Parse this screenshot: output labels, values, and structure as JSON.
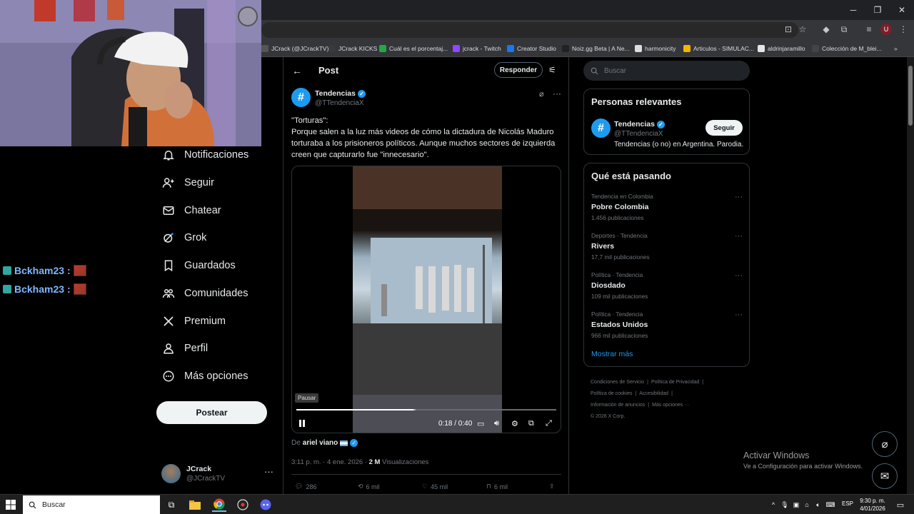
{
  "browser": {
    "window_controls": [
      "─",
      "❐",
      "✕"
    ],
    "bookmarks": [
      {
        "label": "JCrack (@JCrackTV)...",
        "color": "#555555"
      },
      {
        "label": "JCrack KICKS",
        "color": "#3a3a3a"
      },
      {
        "label": "Cuál es el porcentaj...",
        "color": "#22a845"
      },
      {
        "label": "jcrack - Twitch",
        "color": "#9146ff"
      },
      {
        "label": "Creator Studio",
        "color": "#1877f2"
      },
      {
        "label": "Noiz.gg Beta | A Ne...",
        "color": "#222222"
      },
      {
        "label": "harmonicity",
        "color": "#dddddd"
      },
      {
        "label": "Articulos - SIMULAC...",
        "color": "#f4b400"
      },
      {
        "label": "aldrinjaramillo",
        "color": "#e5e5e5"
      },
      {
        "label": "Colección de M_blei...",
        "color": "#444444"
      }
    ]
  },
  "chat": [
    {
      "user": "Bckham23",
      "sep": ":"
    },
    {
      "user": "Bckham23",
      "sep": ":"
    }
  ],
  "nav": {
    "items": [
      {
        "label": "Notificaciones",
        "icon": "bell-icon"
      },
      {
        "label": "Seguir",
        "icon": "person-plus-icon"
      },
      {
        "label": "Chatear",
        "icon": "envelope-icon"
      },
      {
        "label": "Grok",
        "icon": "grok-icon"
      },
      {
        "label": "Guardados",
        "icon": "bookmark-icon"
      },
      {
        "label": "Comunidades",
        "icon": "communities-icon"
      },
      {
        "label": "Premium",
        "icon": "x-logo-icon"
      },
      {
        "label": "Perfil",
        "icon": "person-icon"
      },
      {
        "label": "Más opciones",
        "icon": "more-circle-icon"
      }
    ],
    "post_button": "Postear",
    "account": {
      "name": "JCrack",
      "handle": "@JCrackTV"
    }
  },
  "main": {
    "title": "Post",
    "reply_button": "Responder",
    "tweet": {
      "name": "Tendencias",
      "handle": "@TTendenciaX",
      "text": "\"Torturas\":\nPorque salen a la luz más videos de cómo la dictadura de Nicolás Maduro torturaba a los prisioneros políticos. Aunque muchos sectores de izquierda creen que capturarlo fue \"innecesario\".",
      "video": {
        "tooltip": "Pausar",
        "time": "0:18 / 0:40",
        "progress_fraction": 0.45,
        "buffered_fraction": 0.46
      },
      "from_prefix": "De",
      "from_user": "ariel viano",
      "timestamp": "3:11 p. m. · 4 ene. 2026 ·",
      "views_count": "2 M",
      "views_label": "Visualizaciones",
      "actions": [
        {
          "icon": "reply-icon",
          "count": "286"
        },
        {
          "icon": "retweet-icon",
          "count": "6 mil"
        },
        {
          "icon": "like-icon",
          "count": "45 mil"
        },
        {
          "icon": "bookmark-icon",
          "count": "6 mil"
        }
      ]
    }
  },
  "sidebar": {
    "search_placeholder": "Buscar",
    "relevant": {
      "title": "Personas relevantes",
      "name": "Tendencias",
      "handle": "@TTendenciaX",
      "follow": "Seguir",
      "bio": "Tendencias (o no) en Argentina. Parodia."
    },
    "trends": {
      "title": "Qué está pasando",
      "items": [
        {
          "context": "Tendencia en Colombia",
          "name": "Pobre Colombia",
          "count": "1.456 publicaciones"
        },
        {
          "context": "Deportes · Tendencia",
          "name": "Rivers",
          "count": "17,7 mil publicaciones"
        },
        {
          "context": "Política · Tendencia",
          "name": "Diosdado",
          "count": "109 mil publicaciones"
        },
        {
          "context": "Política · Tendencia",
          "name": "Estados Unidos",
          "count": "966 mil publicaciones"
        }
      ],
      "show_more": "Mostrar más"
    },
    "footer": [
      "Condiciones de Servicio",
      "|",
      "Política de Privacidad",
      "|",
      "Política de cookies",
      "|",
      "Accesibilidad",
      "|",
      "Información de anuncios",
      "|",
      "Más opciones ···",
      "© 2026 X Corp."
    ]
  },
  "windows": {
    "activate_title": "Activar Windows",
    "activate_sub": "Ve a Configuración para activar Windows.",
    "taskbar_search": "Buscar",
    "lang": "ESP",
    "time": "9:30 p. m.",
    "date": "4/01/2026"
  },
  "colors": {
    "accent": "#1d9bf0",
    "background": "#000000",
    "border": "#2f3336"
  }
}
